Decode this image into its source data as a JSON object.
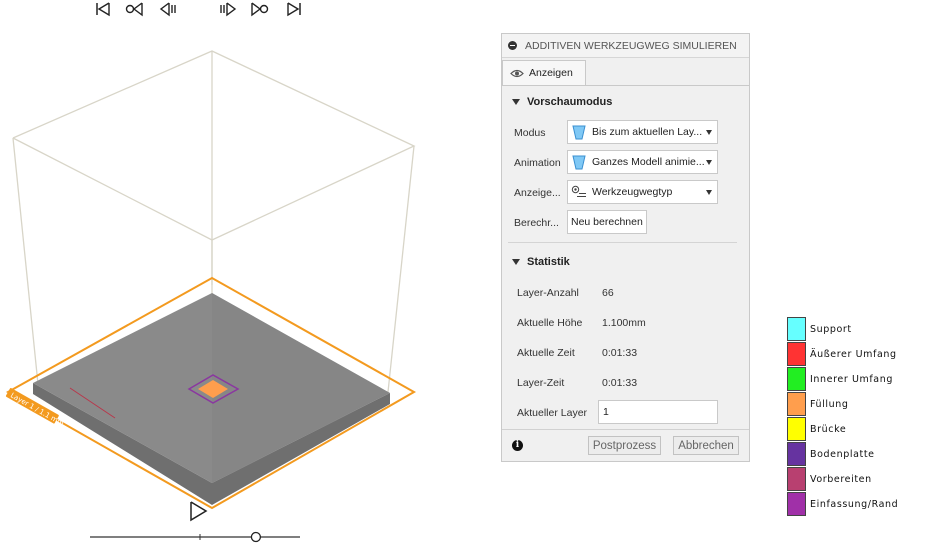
{
  "panel": {
    "title": "ADDITIVEN WERKZEUGWEG SIMULIEREN",
    "tab_label": "Anzeigen",
    "preview_section": "Vorschaumodus",
    "mode_label": "Modus",
    "mode_value": "Bis zum aktuellen Lay...",
    "animation_label": "Animation",
    "animation_value": "Ganzes Modell animie...",
    "display_label": "Anzeige...",
    "display_value": "Werkzeugwegtyp",
    "compute_label": "Berechr...",
    "recompute_button": "Neu berechnen",
    "stats_section": "Statistik",
    "stats": [
      {
        "label": "Layer-Anzahl",
        "value": "66"
      },
      {
        "label": "Aktuelle Höhe",
        "value": "1.100mm"
      },
      {
        "label": "Aktuelle Zeit",
        "value": "0:01:33"
      },
      {
        "label": "Layer-Zeit",
        "value": "0:01:33"
      }
    ],
    "current_layer_label": "Aktueller Layer",
    "current_layer_value": "1",
    "postprocess_button": "Postprozess",
    "cancel_button": "Abbrechen"
  },
  "legend": [
    {
      "label": "Support",
      "color": "#66ffff"
    },
    {
      "label": "Äußerer Umfang",
      "color": "#ff3333"
    },
    {
      "label": "Innerer Umfang",
      "color": "#22ee22"
    },
    {
      "label": "Füllung",
      "color": "#ff9e4d"
    },
    {
      "label": "Brücke",
      "color": "#ffff00"
    },
    {
      "label": "Bodenplatte",
      "color": "#6633a0"
    },
    {
      "label": "Vorbereiten",
      "color": "#b84070"
    },
    {
      "label": "Einfassung/Rand",
      "color": "#a030a8"
    }
  ],
  "viewport": {
    "build_plate_label": "Layer 1 / 1.1 mm",
    "accent_color": "#f39a1f"
  },
  "player": {
    "slider_position": 0.79
  }
}
